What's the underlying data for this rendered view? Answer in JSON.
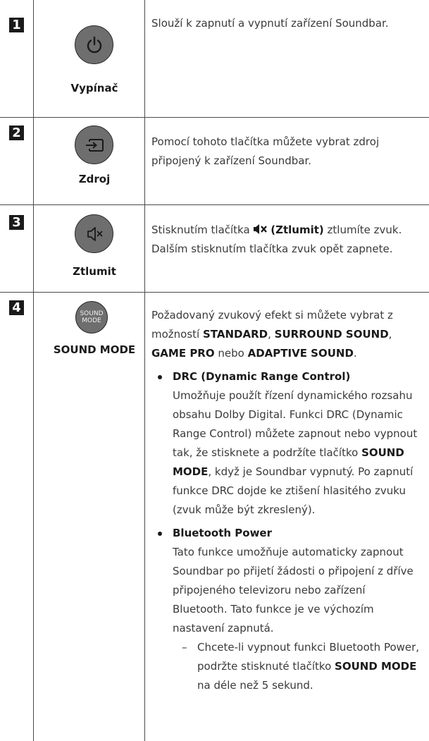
{
  "rows": [
    {
      "number": "1",
      "button_label": "Vypínač",
      "icon": "power-icon",
      "description": "Slouží k zapnutí a vypnutí zařízení Soundbar."
    },
    {
      "number": "2",
      "button_label": "Zdroj",
      "icon": "source-input-icon",
      "description": "Pomocí tohoto tlačítka můžete vybrat zdroj připojený k zařízení Soundbar."
    },
    {
      "number": "3",
      "button_label": "Ztlumit",
      "icon": "mute-icon",
      "description_before": "Stisknutím tlačítka",
      "description_bold": "(Ztlumit)",
      "description_after": "ztlumíte zvuk. Dalším stisknutím tlačítka zvuk opět zapnete."
    },
    {
      "number": "4",
      "button_label": "SOUND MODE",
      "button_text_line1": "SOUND",
      "button_text_line2": "MODE",
      "intro_1": "Požadovaný zvukový efekt si můžete vybrat z možností",
      "opt_standard": "STANDARD",
      "sep_1": ",",
      "opt_surround": "SURROUND SOUND",
      "sep_2": ",",
      "opt_game": "GAME PRO",
      "intro_nebo": "nebo",
      "opt_adaptive": "ADAPTIVE SOUND",
      "intro_end": ".",
      "bullets": [
        {
          "title": "DRC (Dynamic Range Control)",
          "text_before": "Umožňuje použít řízení dynamického rozsahu obsahu Dolby Digital. Funkci DRC (Dynamic Range Control) můžete zapnout nebo vypnout tak, že stisknete a podržíte tlačítko",
          "text_bold": "SOUND MODE",
          "text_after": ", když je Soundbar vypnutý. Po zapnutí funkce DRC dojde ke ztišení hlasitého zvuku (zvuk může být zkreslený)."
        },
        {
          "title": "Bluetooth Power",
          "text": "Tato funkce umožňuje automaticky zapnout Soundbar po přijetí žádosti o připojení z dříve připojeného televizoru nebo zařízení Bluetooth. Tato funkce je ve výchozím nastavení zapnutá.",
          "sub_dash": "–",
          "sub_before": "Chcete-li vypnout funkci Bluetooth Power, podržte stisknuté tlačítko",
          "sub_bold": "SOUND MODE",
          "sub_after": "na déle než 5 sekund."
        }
      ]
    }
  ],
  "colors": {
    "button_fill": "#6e6e6e",
    "number_badge": "#1a1a1a",
    "rule": "#4a4a4a"
  }
}
